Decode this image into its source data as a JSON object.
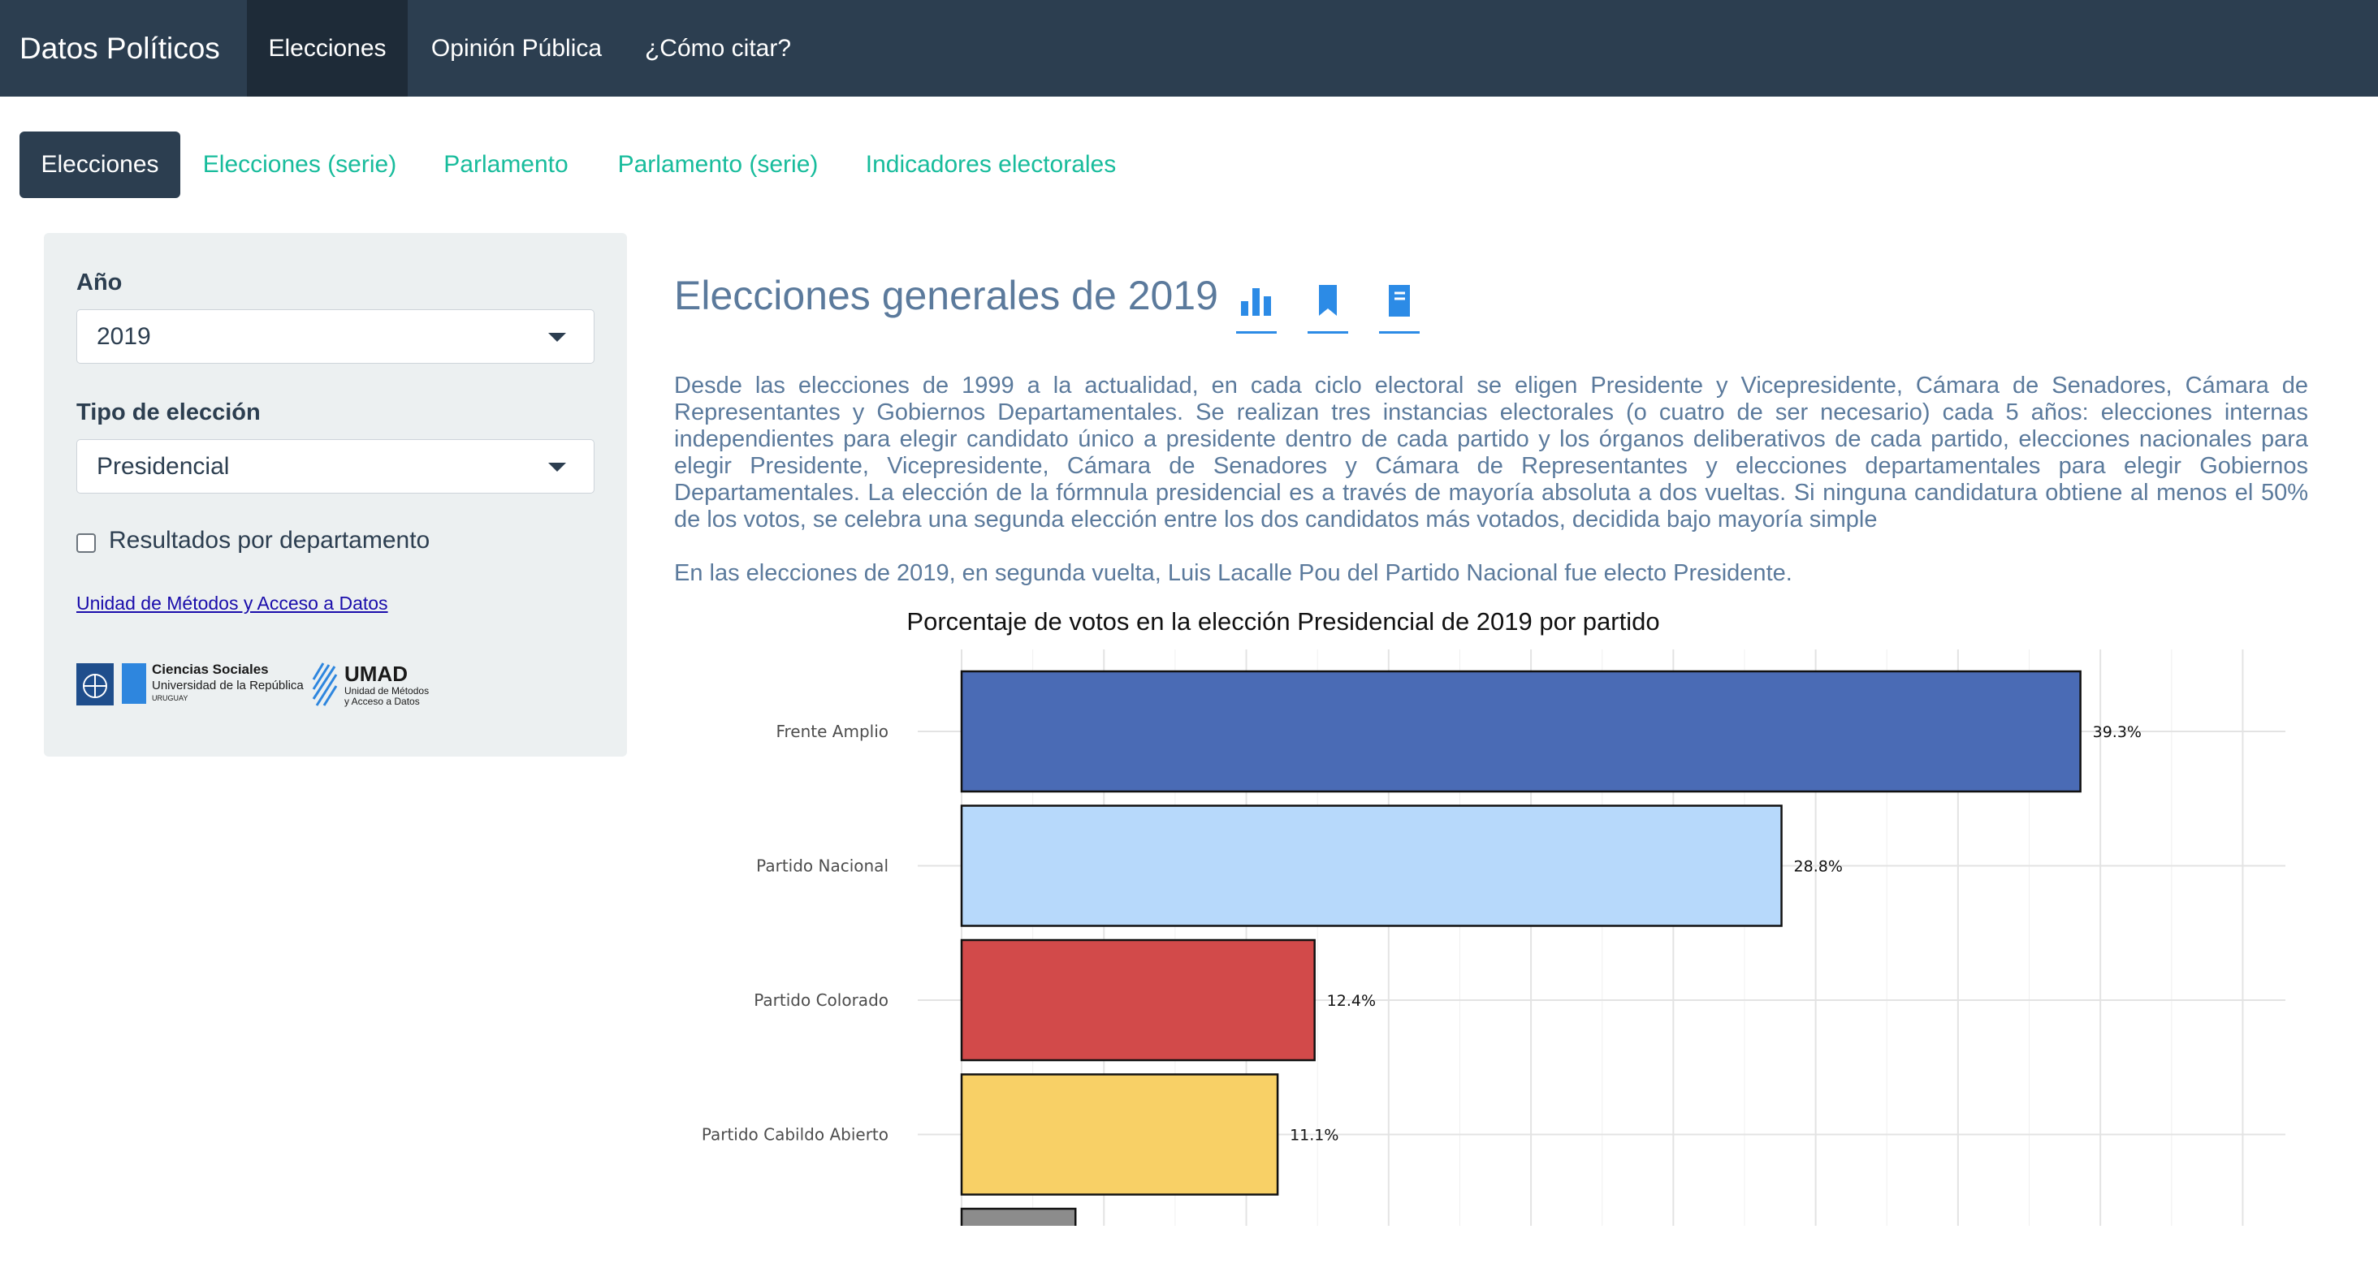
{
  "navbar": {
    "brand": "Datos Políticos",
    "items": [
      {
        "label": "Elecciones",
        "active": true
      },
      {
        "label": "Opinión Pública",
        "active": false
      },
      {
        "label": "¿Cómo citar?",
        "active": false
      }
    ],
    "background": "#2c3e50"
  },
  "tabs": [
    {
      "label": "Elecciones",
      "active": true
    },
    {
      "label": "Elecciones (serie)",
      "active": false
    },
    {
      "label": "Parlamento",
      "active": false
    },
    {
      "label": "Parlamento (serie)",
      "active": false
    },
    {
      "label": "Indicadores electorales",
      "active": false
    }
  ],
  "sidebar": {
    "year_label": "Año",
    "year_value": "2019",
    "type_label": "Tipo de elección",
    "type_value": "Presidencial",
    "department_checkbox_label": "Resultados por departamento",
    "department_checked": false,
    "link_text": "Unidad de Métodos y Acceso a Datos",
    "logos": {
      "cs_line1": "Ciencias Sociales",
      "cs_line2": "Universidad de la República",
      "cs_line3": "URUGUAY",
      "umad_title": "UMAD",
      "umad_line1": "Unidad de Métodos",
      "umad_line2": "y Acceso a Datos"
    }
  },
  "main": {
    "heading": "Elecciones generales de 2019",
    "icons": [
      "bar-chart-icon",
      "bookmark-icon",
      "book-icon"
    ],
    "paragraph1": "Desde las elecciones de 1999 a la actualidad, en cada ciclo electoral se eligen Presidente y Vicepresidente, Cámara de Senadores, Cámara de Representantes y Gobiernos Departamentales. Se realizan tres instancias electorales (o cuatro de ser necesario) cada 5 años: elecciones internas independientes para elegir candidato único a presidente dentro de cada partido y los órganos deliberativos de cada partido, elecciones nacionales para elegir Presidente, Vicepresidente, Cámara de Senadores y Cámara de Representantes y elecciones departamentales para elegir Gobiernos Departamentales. La elección de la fórmnula presidencial es a través de mayoría absoluta a dos vueltas. Si ninguna candidatura obtiene al menos el 50% de los votos, se celebra una segunda elección entre los dos candidatos más votados, decidida bajo mayoría simple",
    "paragraph2": "En las elecciones de 2019, en segunda vuelta, Luis Lacalle Pou del Partido Nacional fue electo Presidente."
  },
  "chart_data": {
    "type": "bar",
    "orientation": "horizontal",
    "title": "Porcentaje de votos en la elección Presidencial de 2019 por partido",
    "categories": [
      "Frente Amplio",
      "Partido Nacional",
      "Partido Colorado",
      "Partido Cabildo Abierto",
      ""
    ],
    "values": [
      39.3,
      28.8,
      12.4,
      11.1,
      4.0
    ],
    "labels": [
      "39.3%",
      "28.8%",
      "12.4%",
      "11.1%",
      ""
    ],
    "colors": [
      "#4a6bb5",
      "#b7d9fb",
      "#d24a4a",
      "#f8d066",
      "#8c8c8c"
    ],
    "xlim": [
      0,
      46.5
    ],
    "grid": true,
    "legend": "none"
  }
}
